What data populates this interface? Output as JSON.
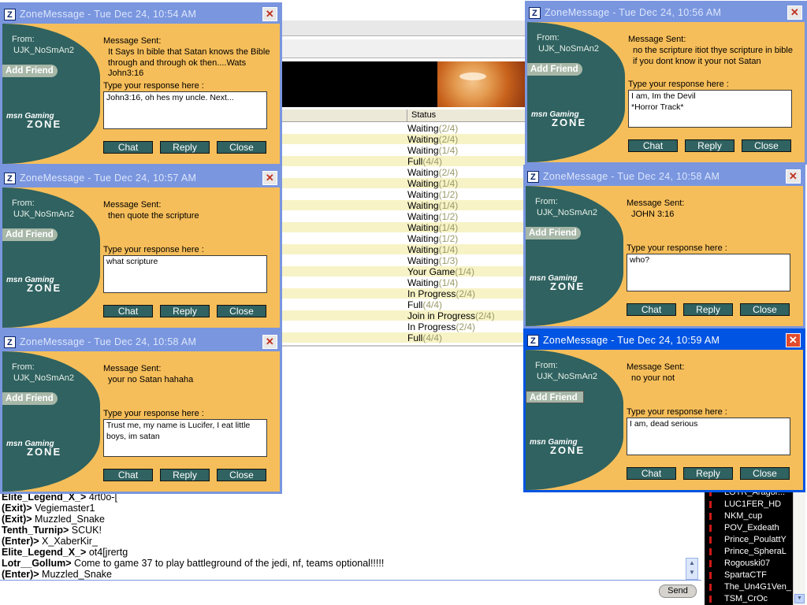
{
  "lobby": {
    "status_header": "Status",
    "status_rows": [
      {
        "state": "Waiting",
        "count": "(2/4)"
      },
      {
        "state": "Waiting",
        "count": "(2/4)"
      },
      {
        "state": "Waiting",
        "count": "(1/4)"
      },
      {
        "state": "Full",
        "count": "(4/4)"
      },
      {
        "state": "Waiting",
        "count": "(2/4)"
      },
      {
        "state": "Waiting",
        "count": "(1/4)"
      },
      {
        "state": "Waiting",
        "count": "(1/2)"
      },
      {
        "state": "Waiting",
        "count": "(1/4)"
      },
      {
        "state": "Waiting",
        "count": "(1/2)"
      },
      {
        "state": "Waiting",
        "count": "(1/4)"
      },
      {
        "state": "Waiting",
        "count": "(1/2)"
      },
      {
        "state": "Waiting",
        "count": "(1/4)"
      },
      {
        "state": "Waiting",
        "count": "(1/3)"
      },
      {
        "state": "Your Game",
        "count": "(1/4)"
      },
      {
        "state": "Waiting",
        "count": "(1/4)"
      },
      {
        "state": "In Progress",
        "count": "(2/4)"
      },
      {
        "state": "Full",
        "count": "(4/4)"
      },
      {
        "state": "Join in Progress",
        "count": "(2/4)"
      },
      {
        "state": "In Progress",
        "count": "(2/4)"
      },
      {
        "state": "Full",
        "count": "(4/4)"
      }
    ]
  },
  "chat": {
    "lines": [
      {
        "who": "Elite_Legend_X_>",
        "text": " 4rt0o-["
      },
      {
        "who": "(Exit)>",
        "text": " Vegiemaster1"
      },
      {
        "who": "(Exit)>",
        "text": " Muzzled_Snake"
      },
      {
        "who": "Tenth_Turnip>",
        "text": " SCUK!"
      },
      {
        "who": "(Enter)>",
        "text": " X_XaberKir_"
      },
      {
        "who": "Elite_Legend_X_>",
        "text": " ot4[jrertg"
      },
      {
        "who": "Lotr__Gollum>",
        "text": " Come to game 37 to play battleground of the jedi, nf, teams optional!!!!!"
      },
      {
        "who": "(Enter)>",
        "text": " Muzzled_Snake"
      }
    ],
    "send_label": "Send"
  },
  "users": [
    "LOTR_Aragor...",
    "LUC1FER_HD",
    "NKM_cup",
    "POV_Exdeath",
    "Prince_PoulattY",
    "Prince_SpheraL",
    "Rogouski07",
    "SpartaCTF",
    "The_Un4G1Ven_",
    "TSM_CrOc"
  ],
  "message_windows": [
    {
      "title": "ZoneMessage - Tue Dec 24, 10:54 AM",
      "from_label": "From:",
      "from": "UJK_NoSmAn2",
      "add_friend": "Add Friend",
      "sent_label": "Message Sent:",
      "sent": "It Says In bible that Satan knows the Bible through and through ok then....Wats John3:16",
      "response_label": "Type your response here :",
      "response": "John3:16, oh hes my uncle. Next...",
      "buttons": {
        "chat": "Chat",
        "reply": "Reply",
        "close": "Close"
      },
      "brand_msn": "msn Gaming",
      "brand_zone": "ZONE"
    },
    {
      "title": "ZoneMessage - Tue Dec 24, 10:56 AM",
      "from_label": "From:",
      "from": "UJK_NoSmAn2",
      "add_friend": "Add Friend",
      "sent_label": "Message Sent:",
      "sent": "no the scripture itiot thye scripture in bible if you dont know it your not Satan",
      "response_label": "Type your response here :",
      "response": "I am, Im the Devil\n*Horror Track*",
      "buttons": {
        "chat": "Chat",
        "reply": "Reply",
        "close": "Close"
      },
      "brand_msn": "msn Gaming",
      "brand_zone": "ZONE"
    },
    {
      "title": "ZoneMessage - Tue Dec 24, 10:57 AM",
      "from_label": "From:",
      "from": "UJK_NoSmAn2",
      "add_friend": "Add Friend",
      "sent_label": "Message Sent:",
      "sent": "then quote the scripture",
      "response_label": "Type your response here :",
      "response": "what scripture",
      "buttons": {
        "chat": "Chat",
        "reply": "Reply",
        "close": "Close"
      },
      "brand_msn": "msn Gaming",
      "brand_zone": "ZONE"
    },
    {
      "title": "ZoneMessage - Tue Dec 24, 10:58 AM",
      "from_label": "From:",
      "from": "UJK_NoSmAn2",
      "add_friend": "Add Friend",
      "sent_label": "Message Sent:",
      "sent": "JOHN 3:16",
      "response_label": "Type your response here :",
      "response": "who?",
      "buttons": {
        "chat": "Chat",
        "reply": "Reply",
        "close": "Close"
      },
      "brand_msn": "msn Gaming",
      "brand_zone": "ZONE"
    },
    {
      "title": "ZoneMessage - Tue Dec 24, 10:58 AM",
      "from_label": "From:",
      "from": "UJK_NoSmAn2",
      "add_friend": "Add Friend",
      "sent_label": "Message Sent:",
      "sent": "your no Satan hahaha",
      "response_label": "Type your response here :",
      "response": "Trust me, my name is Lucifer, I eat little boys, im satan",
      "buttons": {
        "chat": "Chat",
        "reply": "Reply",
        "close": "Close"
      },
      "brand_msn": "msn Gaming",
      "brand_zone": "ZONE"
    },
    {
      "title": "ZoneMessage - Tue Dec 24, 10:59 AM",
      "from_label": "From:",
      "from": "UJK_NoSmAn2",
      "add_friend": "Add Friend",
      "sent_label": "Message Sent:",
      "sent": "no your not",
      "response_label": "Type your response here :",
      "response": "I am, dead serious",
      "buttons": {
        "chat": "Chat",
        "reply": "Reply",
        "close": "Close"
      },
      "brand_msn": "msn Gaming",
      "brand_zone": "ZONE"
    }
  ],
  "colors": {
    "teal": "#2f6260",
    "orange": "#f6be5a",
    "title_active": "#0054e3",
    "title_inactive": "#7a96df"
  },
  "icons": {
    "window": "zone-icon",
    "close": "close-icon"
  }
}
